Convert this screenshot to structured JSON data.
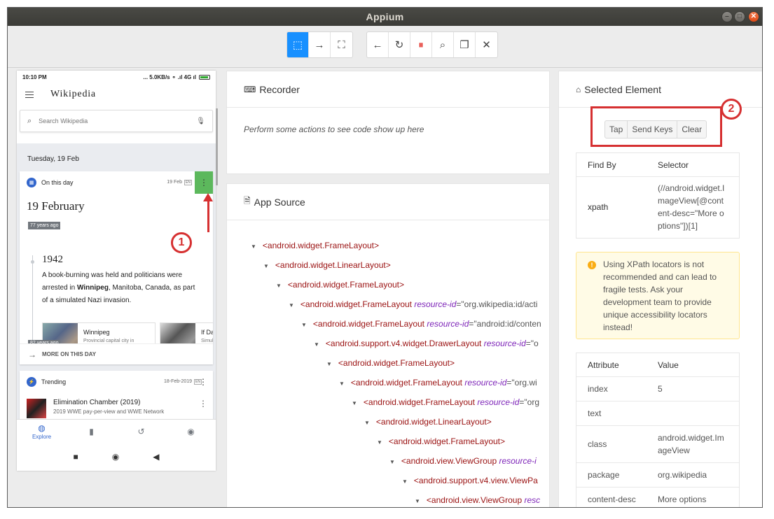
{
  "window": {
    "title": "Appium"
  },
  "toolbar": {
    "group1": [
      {
        "name": "select-elements-icon",
        "glyph": "⬚"
      },
      {
        "name": "swipe-icon",
        "glyph": "→"
      },
      {
        "name": "tap-coordinates-icon",
        "glyph": "⛶"
      }
    ],
    "group2": [
      {
        "name": "back-icon",
        "glyph": "←"
      },
      {
        "name": "refresh-icon",
        "glyph": "↻"
      },
      {
        "name": "pause-recording-icon",
        "glyph": "⏸"
      },
      {
        "name": "search-icon",
        "glyph": "⌕"
      },
      {
        "name": "copy-xml-icon",
        "glyph": "❐"
      },
      {
        "name": "quit-session-icon",
        "glyph": "✕"
      }
    ]
  },
  "phone": {
    "status": {
      "time": "10:10 PM",
      "right": "... 5.0KB/s ⚬ .ıl 4G ıl"
    },
    "app_name": "Wikipedia",
    "search_placeholder": "Search Wikipedia",
    "date_header": "Tuesday, 19 Feb",
    "on_this_day": {
      "label": "On this day",
      "date": "19 Feb",
      "lang": "EN",
      "big_date": "19 February",
      "years_ago": "77 years ago",
      "year": "1942",
      "text_before": "A book-burning was held and politicians were arrested in ",
      "text_bold": "Winnipeg",
      "text_after": ", Manitoba, Canada, as part of a simulated Nazi invasion.",
      "link1_title": "Winnipeg",
      "link1_sub": "Provincial capital city in Manitoba, Canada",
      "link2_title": "If Day",
      "link2_sub": "Simul...",
      "years_ago2": "82 years ago",
      "more": "MORE ON THIS DAY"
    },
    "trending": {
      "label": "Trending",
      "date": "18-Feb-2019",
      "lang": "EN",
      "item_title": "Elimination Chamber (2019)",
      "item_sub": "2019 WWE pay-per-view and WWE Network"
    },
    "nav": {
      "explore": "Explore"
    }
  },
  "recorder": {
    "title": "Recorder",
    "message": "Perform some actions to see code show up here"
  },
  "app_source": {
    "title": "App Source",
    "nodes": [
      {
        "indent": 0,
        "tag": "<android.widget.FrameLayout>",
        "attr": "",
        "val": ""
      },
      {
        "indent": 1,
        "tag": "<android.widget.LinearLayout>",
        "attr": "",
        "val": ""
      },
      {
        "indent": 2,
        "tag": "<android.widget.FrameLayout>",
        "attr": "",
        "val": ""
      },
      {
        "indent": 3,
        "tag": "<android.widget.FrameLayout ",
        "attr": "resource-id",
        "val": "=\"org.wikipedia:id/acti"
      },
      {
        "indent": 4,
        "tag": "<android.widget.FrameLayout ",
        "attr": "resource-id",
        "val": "=\"android:id/conten"
      },
      {
        "indent": 5,
        "tag": "<android.support.v4.widget.DrawerLayout ",
        "attr": "resource-id",
        "val": "=\"o"
      },
      {
        "indent": 6,
        "tag": "<android.widget.FrameLayout>",
        "attr": "",
        "val": ""
      },
      {
        "indent": 7,
        "tag": "<android.widget.FrameLayout ",
        "attr": "resource-id",
        "val": "=\"org.wi"
      },
      {
        "indent": 8,
        "tag": "<android.widget.FrameLayout ",
        "attr": "resource-id",
        "val": "=\"org"
      },
      {
        "indent": 9,
        "tag": "<android.widget.LinearLayout>",
        "attr": "",
        "val": ""
      },
      {
        "indent": 10,
        "tag": "<android.widget.FrameLayout>",
        "attr": "",
        "val": ""
      },
      {
        "indent": 11,
        "tag": "<android.view.ViewGroup ",
        "attr": "resource-i",
        "val": ""
      },
      {
        "indent": 12,
        "tag": "<android.support.v4.view.ViewPa",
        "attr": "",
        "val": ""
      },
      {
        "indent": 13,
        "tag": "<android.view.ViewGroup ",
        "attr": "resc",
        "val": ""
      }
    ]
  },
  "selected_element": {
    "title": "Selected Element",
    "actions": {
      "tap": "Tap",
      "send_keys": "Send Keys",
      "clear": "Clear"
    },
    "find_by_header": "Find By",
    "selector_header": "Selector",
    "find_by": "xpath",
    "selector": "(//android.widget.ImageView[@content-desc=\"More options\"])[1]",
    "warning": "Using XPath locators is not recommended and can lead to fragile tests. Ask your development team to provide unique accessibility locators instead!",
    "attr_header": "Attribute",
    "value_header": "Value",
    "attributes": [
      {
        "name": "index",
        "value": "5"
      },
      {
        "name": "text",
        "value": ""
      },
      {
        "name": "class",
        "value": "android.widget.ImageView"
      },
      {
        "name": "package",
        "value": "org.wikipedia"
      },
      {
        "name": "content-desc",
        "value": "More options"
      }
    ]
  },
  "annotations": {
    "one": "1",
    "two": "2",
    "color": "#d63031"
  }
}
